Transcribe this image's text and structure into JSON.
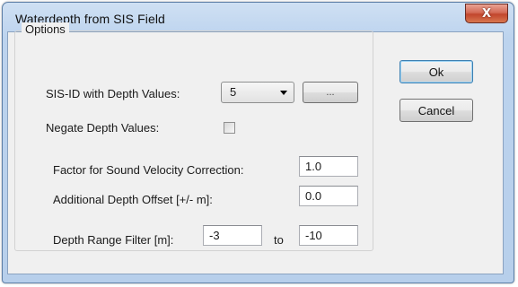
{
  "window": {
    "title": "Waterdepth from SIS Field",
    "close_glyph": "X"
  },
  "options": {
    "group_label": "Options",
    "sis_id_label": "SIS-ID with Depth Values:",
    "sis_id_value": "5",
    "browse_label": "...",
    "negate_label": "Negate Depth Values:",
    "negate_checked": false,
    "factor_label": "Factor for Sound Velocity Correction:",
    "factor_value": "1.0",
    "offset_label": "Additional Depth Offset [+/- m]:",
    "offset_value": "0.0",
    "range_label": "Depth Range Filter [m]:",
    "range_from": "-3",
    "range_to_label": "to",
    "range_to": "-10"
  },
  "buttons": {
    "ok_label": "Ok",
    "cancel_label": "Cancel"
  },
  "icons": {
    "close": "close-icon",
    "dropdown": "chevron-down-icon"
  },
  "colors": {
    "frame": "#bcd3ee",
    "close_button": "#c2452d",
    "dialog_bg": "#f0f0f0",
    "default_button_border": "#3c7fb1"
  }
}
